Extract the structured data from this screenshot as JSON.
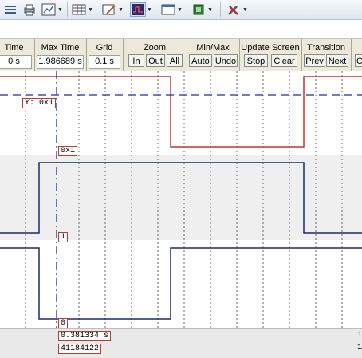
{
  "controls": {
    "time_title": "Time",
    "time_value": "0 s",
    "max_time_title": "Max Time",
    "max_time_value": "1.986689 s",
    "grid_title": "Grid",
    "grid_value": "0.1 s",
    "zoom_title": "Zoom",
    "zoom_in": "In",
    "zoom_out": "Out",
    "zoom_all": "All",
    "minmax_title": "Min/Max",
    "minmax_auto": "Auto",
    "minmax_undo": "Undo",
    "update_title": "Update Screen",
    "update_stop": "Stop",
    "update_clear": "Clear",
    "transition_title": "Transition",
    "transition_prev": "Prev",
    "transition_next": "Next",
    "trailing_button": "C"
  },
  "plot": {
    "cursor_label": "Y: 0x1",
    "value_tag_1": "0x1",
    "value_tag_2": "1",
    "value_tag_3": "0",
    "time_readout": "0.381334 s",
    "sample_readout": "41184122"
  },
  "status": {
    "right_1": "1",
    "right_2": "1"
  },
  "colors": {
    "trace_red": "#c0392b",
    "trace_blue": "#1f2a6b",
    "cursor_blue": "#1a2fa0"
  }
}
